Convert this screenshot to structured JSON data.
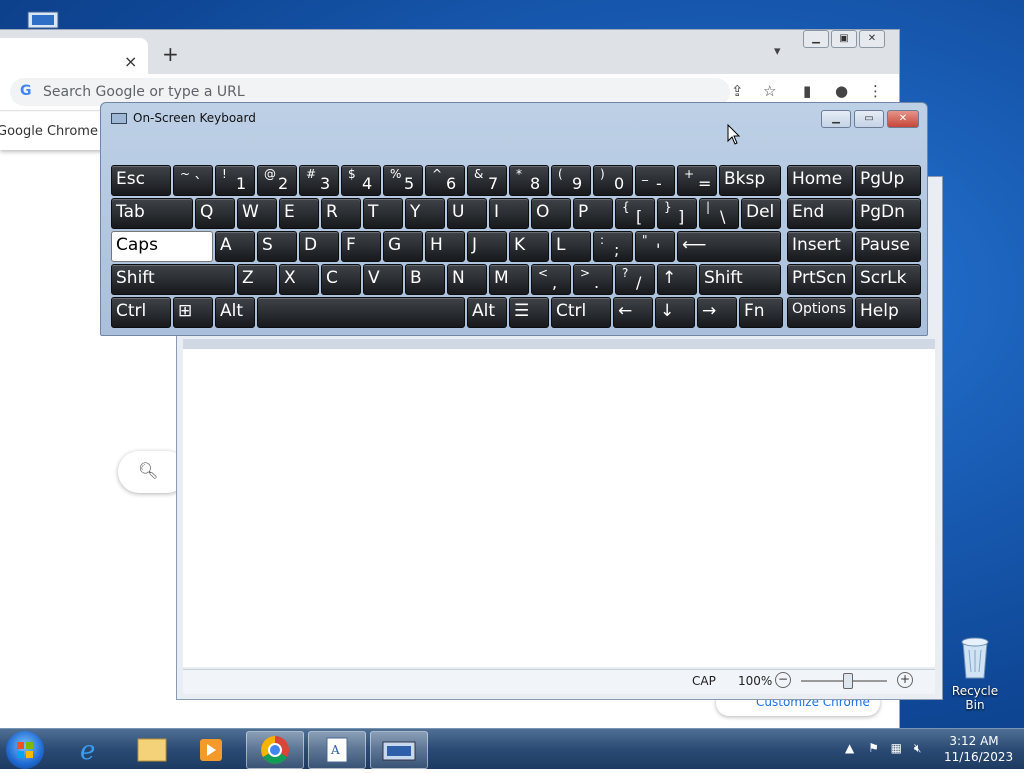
{
  "chrome": {
    "omnibox_placeholder": "Search Google or type a URL",
    "tab_close": "×",
    "new_tab": "+",
    "infobar_text": "Google Chrome up",
    "customize_label": "Customize Chrome"
  },
  "wordpad": {
    "caps_indicator": "CAP",
    "zoom_level": "100%",
    "zoom_minus": "−",
    "zoom_plus": "+"
  },
  "osk": {
    "title": "On-Screen Keyboard",
    "rows": [
      [
        {
          "main": "Esc"
        },
        {
          "top": "~",
          "main": "`"
        },
        {
          "top": "!",
          "main": "1"
        },
        {
          "top": "@",
          "main": "2"
        },
        {
          "top": "#",
          "main": "3"
        },
        {
          "top": "$",
          "main": "4"
        },
        {
          "top": "%",
          "main": "5"
        },
        {
          "top": "^",
          "main": "6"
        },
        {
          "top": "&",
          "main": "7"
        },
        {
          "top": "*",
          "main": "8"
        },
        {
          "top": "(",
          "main": "9"
        },
        {
          "top": ")",
          "main": "0"
        },
        {
          "top": "_",
          "main": "-"
        },
        {
          "top": "+",
          "main": "="
        },
        {
          "main": "Bksp"
        },
        {
          "main": "Home"
        },
        {
          "main": "PgUp"
        }
      ],
      [
        {
          "main": "Tab"
        },
        {
          "main": "Q"
        },
        {
          "main": "W"
        },
        {
          "main": "E"
        },
        {
          "main": "R"
        },
        {
          "main": "T"
        },
        {
          "main": "Y"
        },
        {
          "main": "U"
        },
        {
          "main": "I"
        },
        {
          "main": "O"
        },
        {
          "main": "P"
        },
        {
          "top": "{",
          "main": "["
        },
        {
          "top": "}",
          "main": "]"
        },
        {
          "top": "|",
          "main": "\\"
        },
        {
          "main": "Del"
        },
        {
          "main": "End"
        },
        {
          "main": "PgDn"
        }
      ],
      [
        {
          "main": "Caps"
        },
        {
          "main": "A"
        },
        {
          "main": "S"
        },
        {
          "main": "D"
        },
        {
          "main": "F"
        },
        {
          "main": "G"
        },
        {
          "main": "H"
        },
        {
          "main": "J"
        },
        {
          "main": "K"
        },
        {
          "main": "L"
        },
        {
          "top": ":",
          "main": ";"
        },
        {
          "top": "\"",
          "main": "'"
        },
        {
          "main": "⟵"
        },
        {
          "main": "Insert"
        },
        {
          "main": "Pause"
        }
      ],
      [
        {
          "main": "Shift"
        },
        {
          "main": "Z"
        },
        {
          "main": "X"
        },
        {
          "main": "C"
        },
        {
          "main": "V"
        },
        {
          "main": "B"
        },
        {
          "main": "N"
        },
        {
          "main": "M"
        },
        {
          "top": "<",
          "main": ","
        },
        {
          "top": ">",
          "main": "."
        },
        {
          "top": "?",
          "main": "/"
        },
        {
          "main": "↑"
        },
        {
          "main": "Shift"
        },
        {
          "main": "PrtScn"
        },
        {
          "main": "ScrLk"
        }
      ],
      [
        {
          "main": "Ctrl"
        },
        {
          "main": "⊞"
        },
        {
          "main": "Alt"
        },
        {
          "main": ""
        },
        {
          "main": "Alt"
        },
        {
          "main": "☰"
        },
        {
          "main": "Ctrl"
        },
        {
          "main": "←"
        },
        {
          "main": "↓"
        },
        {
          "main": "→"
        },
        {
          "main": "Fn"
        },
        {
          "main": "Options"
        },
        {
          "main": "Help"
        }
      ]
    ]
  },
  "desktop": {
    "recycle_bin_label": "Recycle Bin"
  },
  "taskbar": {
    "time": "3:12 AM",
    "date": "11/16/2023"
  }
}
